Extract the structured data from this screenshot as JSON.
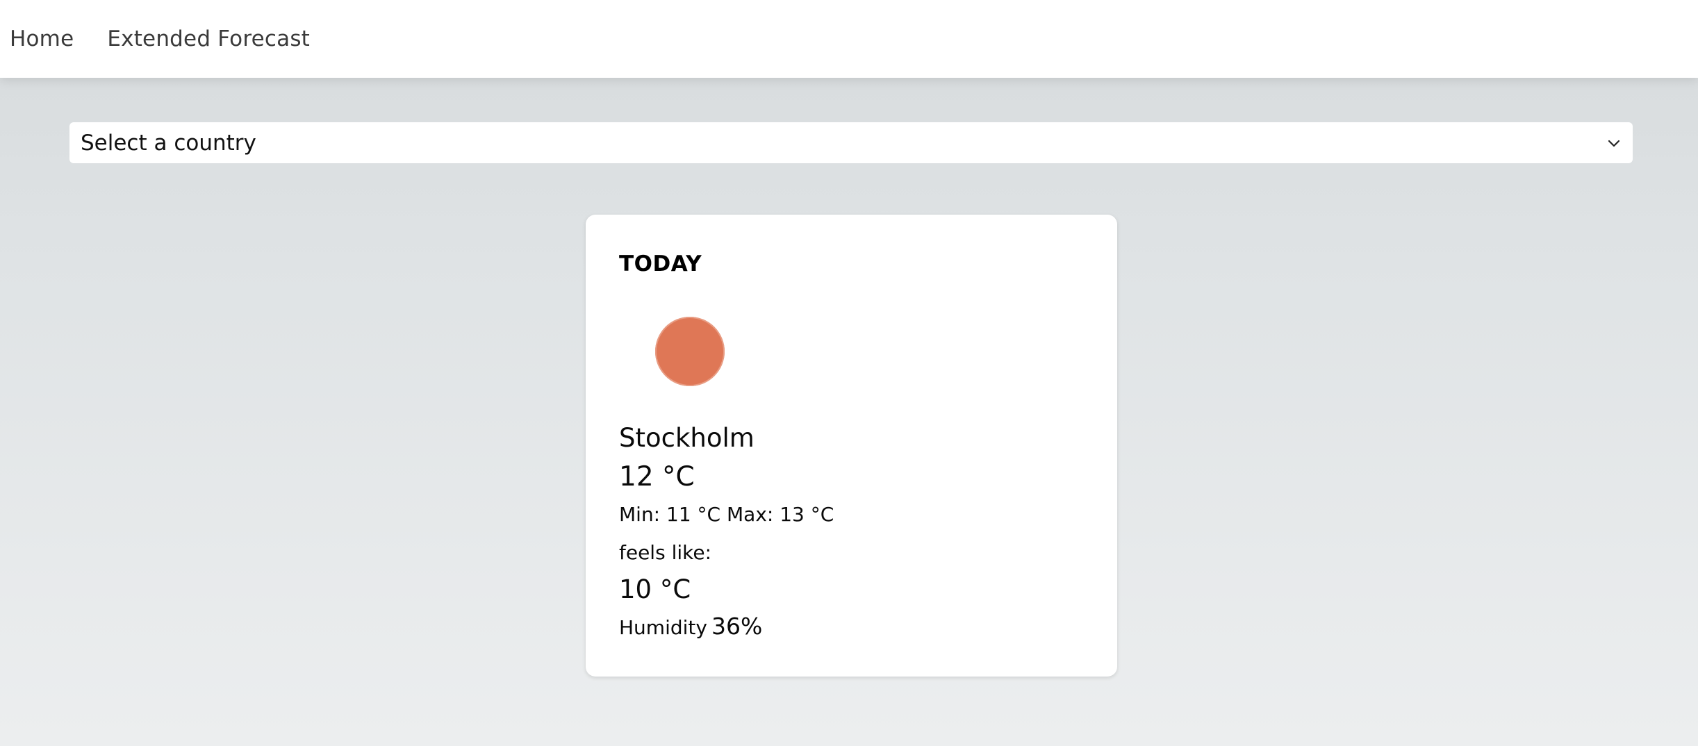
{
  "nav": {
    "items": [
      {
        "label": "Home"
      },
      {
        "label": "Extended Forecast"
      }
    ]
  },
  "country_select": {
    "selected": "Select a country",
    "icon": "chevron-down-icon"
  },
  "card": {
    "title": "TODAY",
    "icon": "weather-condition-icon",
    "icon_color": "#df7756",
    "city": "Stockholm",
    "temperature": "12 °C",
    "min_max": "Min: 11 °C Max: 13 °C",
    "feels_like_label": "feels like:",
    "feels_like_value": "10 °C",
    "humidity_label": "Humidity",
    "humidity_value": "36%"
  }
}
